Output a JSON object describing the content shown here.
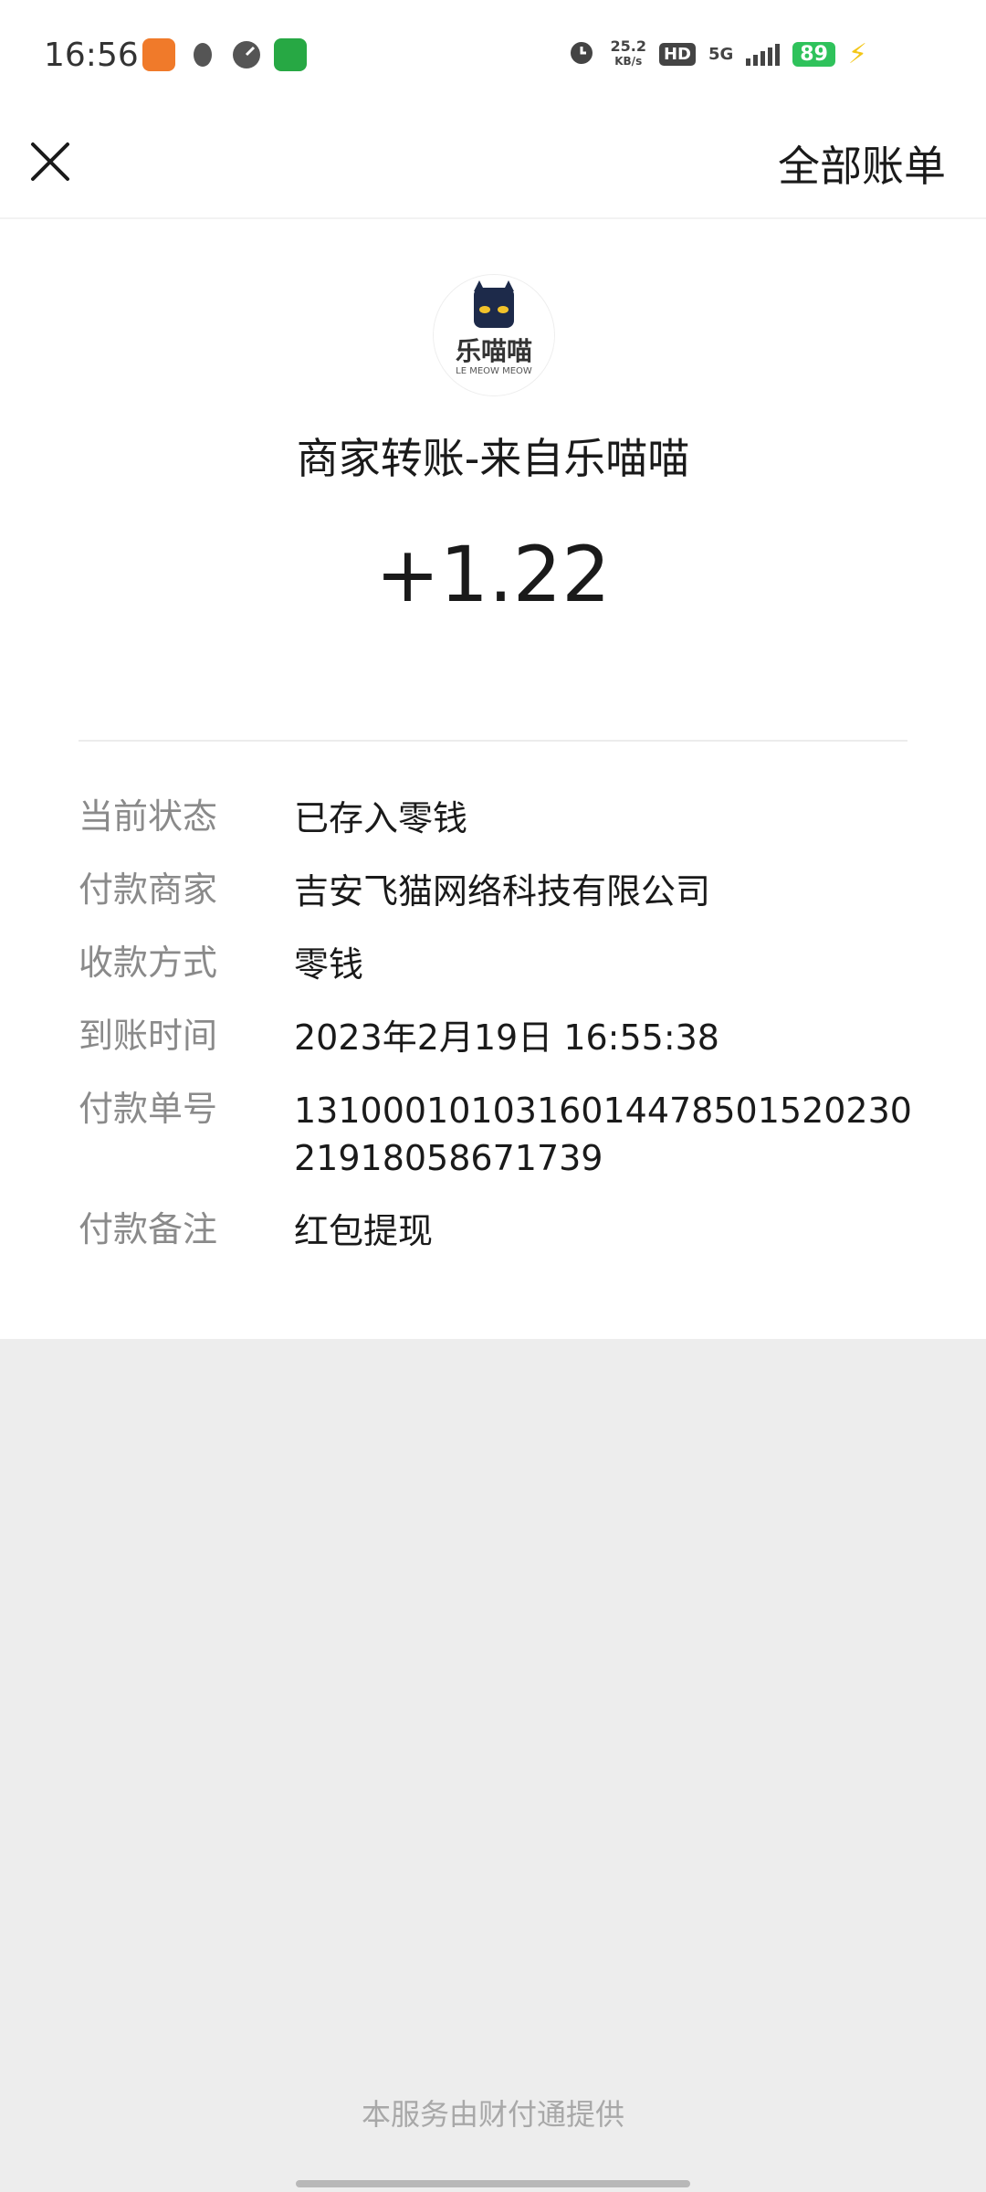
{
  "status_bar": {
    "time": "16:56",
    "net_speed_value": "25.2",
    "net_speed_unit": "KB/s",
    "hd": "HD",
    "network": "5G",
    "battery": "89"
  },
  "header": {
    "all_bills": "全部账单"
  },
  "merchant": {
    "logo_text": "乐喵喵",
    "logo_subtext": "LE MEOW MEOW",
    "title": "商家转账-来自乐喵喵",
    "amount": "+1.22"
  },
  "details": [
    {
      "label": "当前状态",
      "value": "已存入零钱"
    },
    {
      "label": "付款商家",
      "value": "吉安飞猫网络科技有限公司"
    },
    {
      "label": "收款方式",
      "value": "零钱"
    },
    {
      "label": "到账时间",
      "value": "2023年2月19日 16:55:38"
    },
    {
      "label": "付款单号",
      "value": "131000101031601447850152023021918058671739"
    },
    {
      "label": "付款备注",
      "value": "红包提现"
    }
  ],
  "footer": {
    "provider": "本服务由财付通提供"
  }
}
